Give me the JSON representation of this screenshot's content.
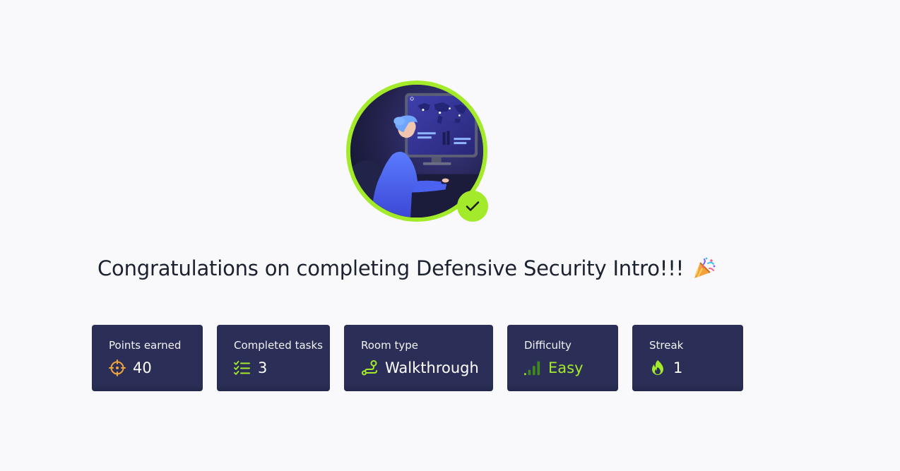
{
  "headline": {
    "text": "Congratulations on completing Defensive Security Intro!!!",
    "emoji_icon": "party-popper-icon"
  },
  "avatar": {
    "image": "analyst-at-world-map-monitor-illustration",
    "badge_icon": "check-icon"
  },
  "stats": [
    {
      "label": "Points earned",
      "value": "40",
      "icon": "target-icon",
      "icon_color": "#f1a33b"
    },
    {
      "label": "Completed tasks",
      "value": "3",
      "icon": "checklist-icon",
      "icon_color": "#a3ea2a"
    },
    {
      "label": "Room type",
      "value": "Walkthrough",
      "icon": "route-icon",
      "icon_color": "#a3ea2a"
    },
    {
      "label": "Difficulty",
      "value": "Easy",
      "icon": "signal-bars-icon",
      "icon_color": "#a3ea2a"
    },
    {
      "label": "Streak",
      "value": "1",
      "icon": "flame-icon",
      "icon_color": "#a3ea2a"
    }
  ],
  "colors": {
    "accent": "#a3ea2a",
    "card_bg": "#2b2f57",
    "page_bg": "#f9f9fb",
    "headline": "#1c2130"
  }
}
